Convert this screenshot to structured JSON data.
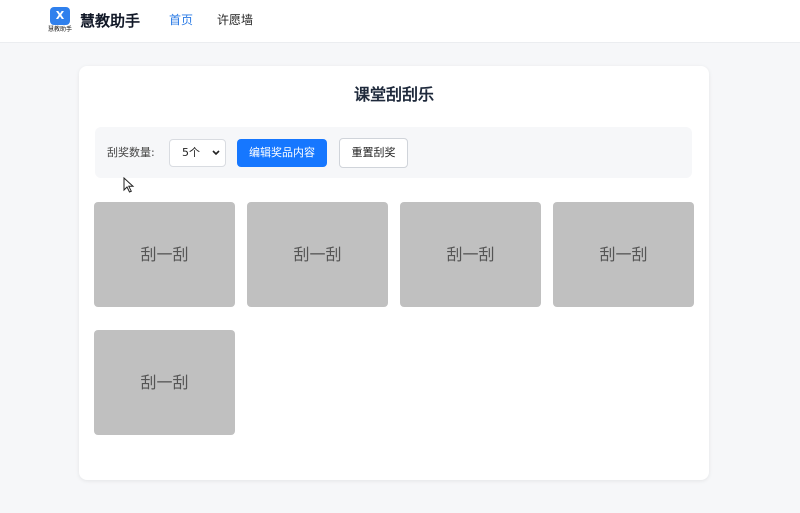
{
  "header": {
    "logo_glyph": "X",
    "logo_caption": "慧教助手",
    "brand": "慧教助手",
    "nav": [
      "首页",
      "许愿墙"
    ],
    "active_color": "#2b7be5"
  },
  "main": {
    "title": "课堂刮刮乐",
    "controls": {
      "count_label": "刮奖数量:",
      "count_value": "5个",
      "edit_button": "编辑奖品内容",
      "reset_button": "重置刮奖"
    },
    "tiles": [
      "刮一刮",
      "刮一刮",
      "刮一刮",
      "刮一刮",
      "刮一刮"
    ],
    "tile_color": "#c0c0c0",
    "primary_color": "#1677ff"
  }
}
